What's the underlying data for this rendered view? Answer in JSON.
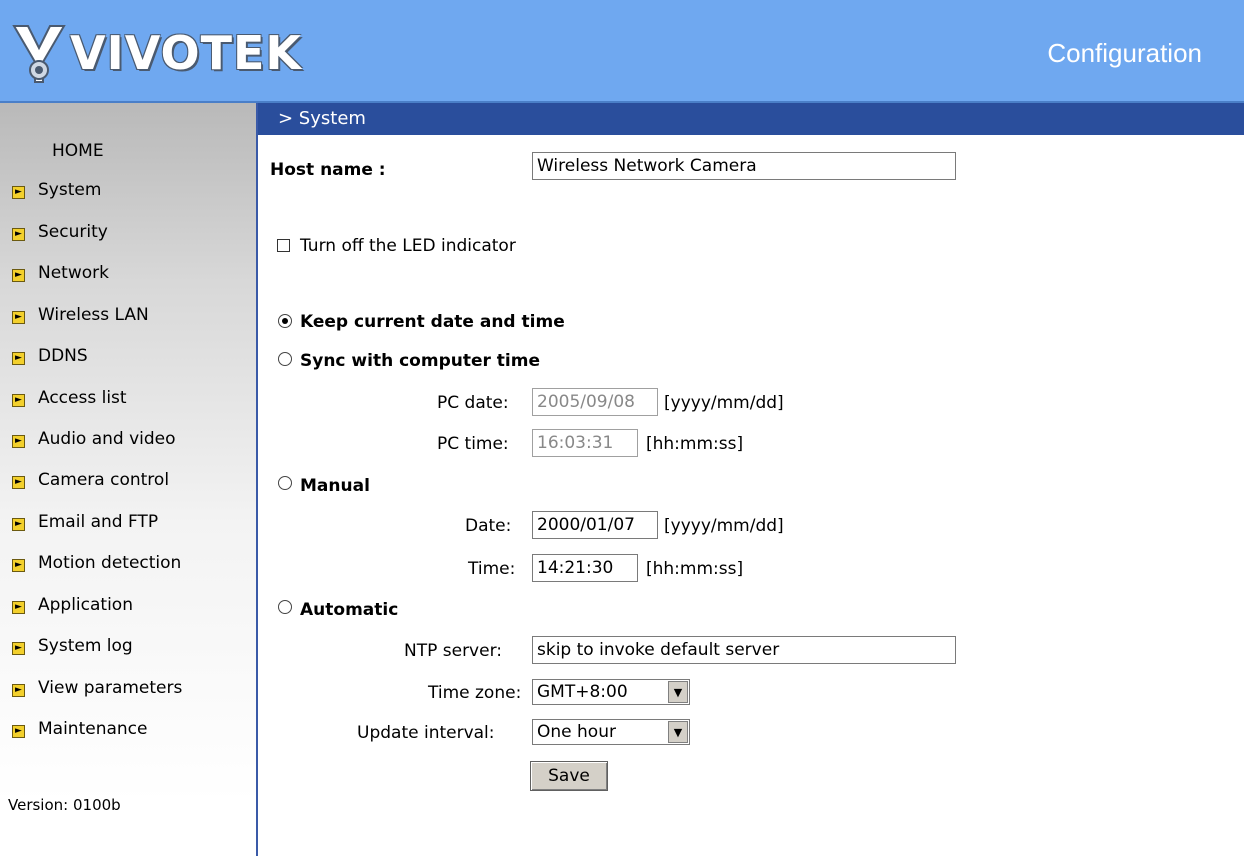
{
  "header": {
    "brand": "VIVOTEK",
    "title": "Configuration"
  },
  "sidebar": {
    "home": "HOME",
    "items": [
      "System",
      "Security",
      "Network",
      "Wireless LAN",
      "DDNS",
      "Access list",
      "Audio and video",
      "Camera control",
      "Email and FTP",
      "Motion detection",
      "Application",
      "System log",
      "View parameters",
      "Maintenance"
    ],
    "version": "Version: 0100b"
  },
  "section": {
    "title": "> System"
  },
  "form": {
    "host_name_label": "Host name :",
    "host_name_value": "Wireless Network Camera",
    "led_label": "Turn off the LED indicator",
    "led_checked": false,
    "keep_label": "Keep current date and time",
    "keep_checked": true,
    "sync_label": "Sync with computer time",
    "pc_date_label": "PC date:",
    "pc_date_value": "2005/09/08",
    "pc_date_format": "[yyyy/mm/dd]",
    "pc_time_label": "PC time:",
    "pc_time_value": "16:03:31",
    "pc_time_format": "[hh:mm:ss]",
    "manual_label": "Manual",
    "date_label": "Date:",
    "date_value": "2000/01/07",
    "date_format": "[yyyy/mm/dd]",
    "time_label": "Time:",
    "time_value": "14:21:30",
    "time_format": "[hh:mm:ss]",
    "automatic_label": "Automatic",
    "ntp_label": "NTP server:",
    "ntp_value": "skip to invoke default server",
    "tz_label": "Time zone:",
    "tz_value": "GMT+8:00",
    "interval_label": "Update interval:",
    "interval_value": "One hour",
    "save_label": "Save"
  }
}
